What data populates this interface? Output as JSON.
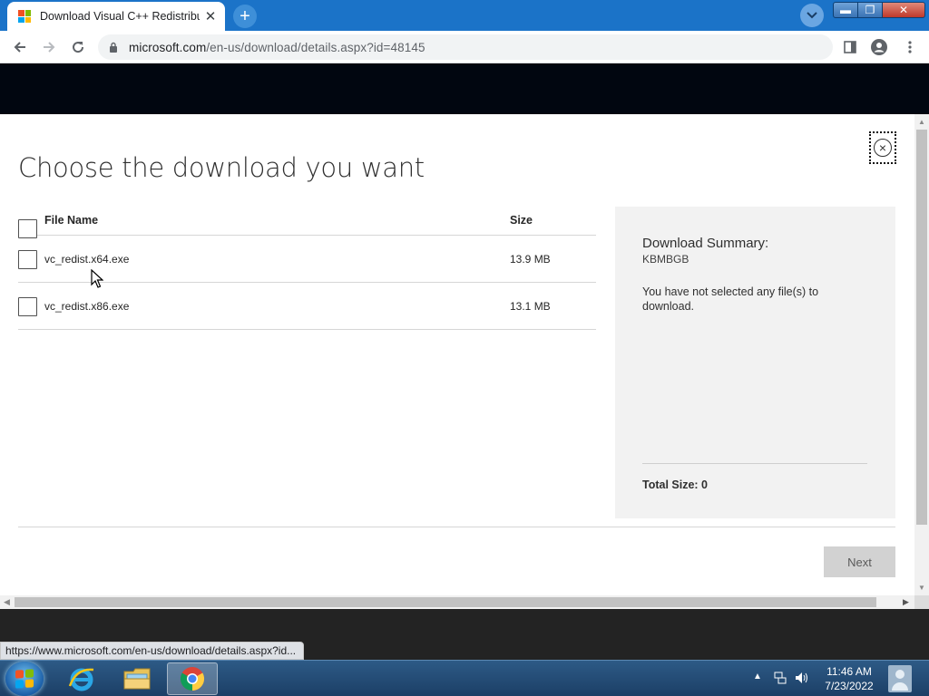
{
  "browser": {
    "tab_title": "Download Visual C++ Redistribu",
    "tab_close": "✕",
    "new_tab": "+",
    "url_host": "microsoft.com",
    "url_path": "/en-us/download/details.aspx?id=48145",
    "status_url": "https://www.microsoft.com/en-us/download/details.aspx?id...",
    "window_buttons": {
      "minimize": "▬",
      "maximize": "❐",
      "close": "✕"
    },
    "icons": [
      "back-arrow-icon",
      "forward-arrow-icon",
      "reload-icon",
      "lock-icon",
      "share-icon",
      "star-icon",
      "side-panel-icon",
      "profile-icon",
      "menu-icon"
    ]
  },
  "dialog": {
    "title": "Choose the download you want",
    "table": {
      "headers": {
        "name": "File Name",
        "size": "Size"
      },
      "rows": [
        {
          "name": "vc_redist.x64.exe",
          "size": "13.9 MB"
        },
        {
          "name": "vc_redist.x86.exe",
          "size": "13.1 MB"
        }
      ]
    },
    "summary": {
      "title": "Download Summary:",
      "code": "KBMBGB",
      "message": "You have not selected any file(s) to download.",
      "total": "Total Size: 0"
    },
    "next_label": "Next"
  },
  "taskbar": {
    "time": "11:46 AM",
    "date": "7/23/2022",
    "apps": [
      "internet-explorer",
      "file-explorer",
      "chrome"
    ]
  },
  "colors": {
    "tab_strip": "#1b73c8",
    "page_header": "#010610",
    "summary_bg": "#f2f2f2",
    "next_disabled": "#d2d2d2"
  }
}
